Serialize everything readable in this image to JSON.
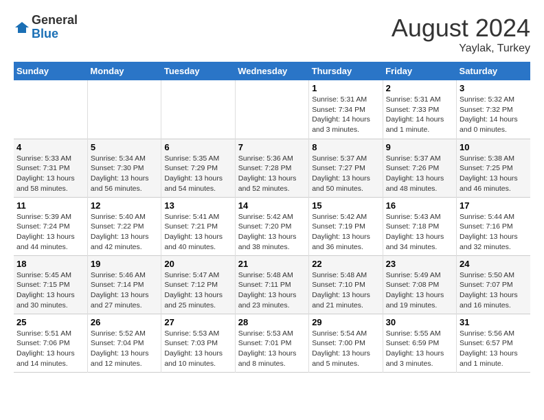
{
  "header": {
    "logo_general": "General",
    "logo_blue": "Blue",
    "month_year": "August 2024",
    "location": "Yaylak, Turkey"
  },
  "days_of_week": [
    "Sunday",
    "Monday",
    "Tuesday",
    "Wednesday",
    "Thursday",
    "Friday",
    "Saturday"
  ],
  "weeks": [
    [
      {
        "day": "",
        "info": ""
      },
      {
        "day": "",
        "info": ""
      },
      {
        "day": "",
        "info": ""
      },
      {
        "day": "",
        "info": ""
      },
      {
        "day": "1",
        "info": "Sunrise: 5:31 AM\nSunset: 7:34 PM\nDaylight: 14 hours\nand 3 minutes."
      },
      {
        "day": "2",
        "info": "Sunrise: 5:31 AM\nSunset: 7:33 PM\nDaylight: 14 hours\nand 1 minute."
      },
      {
        "day": "3",
        "info": "Sunrise: 5:32 AM\nSunset: 7:32 PM\nDaylight: 14 hours\nand 0 minutes."
      }
    ],
    [
      {
        "day": "4",
        "info": "Sunrise: 5:33 AM\nSunset: 7:31 PM\nDaylight: 13 hours\nand 58 minutes."
      },
      {
        "day": "5",
        "info": "Sunrise: 5:34 AM\nSunset: 7:30 PM\nDaylight: 13 hours\nand 56 minutes."
      },
      {
        "day": "6",
        "info": "Sunrise: 5:35 AM\nSunset: 7:29 PM\nDaylight: 13 hours\nand 54 minutes."
      },
      {
        "day": "7",
        "info": "Sunrise: 5:36 AM\nSunset: 7:28 PM\nDaylight: 13 hours\nand 52 minutes."
      },
      {
        "day": "8",
        "info": "Sunrise: 5:37 AM\nSunset: 7:27 PM\nDaylight: 13 hours\nand 50 minutes."
      },
      {
        "day": "9",
        "info": "Sunrise: 5:37 AM\nSunset: 7:26 PM\nDaylight: 13 hours\nand 48 minutes."
      },
      {
        "day": "10",
        "info": "Sunrise: 5:38 AM\nSunset: 7:25 PM\nDaylight: 13 hours\nand 46 minutes."
      }
    ],
    [
      {
        "day": "11",
        "info": "Sunrise: 5:39 AM\nSunset: 7:24 PM\nDaylight: 13 hours\nand 44 minutes."
      },
      {
        "day": "12",
        "info": "Sunrise: 5:40 AM\nSunset: 7:22 PM\nDaylight: 13 hours\nand 42 minutes."
      },
      {
        "day": "13",
        "info": "Sunrise: 5:41 AM\nSunset: 7:21 PM\nDaylight: 13 hours\nand 40 minutes."
      },
      {
        "day": "14",
        "info": "Sunrise: 5:42 AM\nSunset: 7:20 PM\nDaylight: 13 hours\nand 38 minutes."
      },
      {
        "day": "15",
        "info": "Sunrise: 5:42 AM\nSunset: 7:19 PM\nDaylight: 13 hours\nand 36 minutes."
      },
      {
        "day": "16",
        "info": "Sunrise: 5:43 AM\nSunset: 7:18 PM\nDaylight: 13 hours\nand 34 minutes."
      },
      {
        "day": "17",
        "info": "Sunrise: 5:44 AM\nSunset: 7:16 PM\nDaylight: 13 hours\nand 32 minutes."
      }
    ],
    [
      {
        "day": "18",
        "info": "Sunrise: 5:45 AM\nSunset: 7:15 PM\nDaylight: 13 hours\nand 30 minutes."
      },
      {
        "day": "19",
        "info": "Sunrise: 5:46 AM\nSunset: 7:14 PM\nDaylight: 13 hours\nand 27 minutes."
      },
      {
        "day": "20",
        "info": "Sunrise: 5:47 AM\nSunset: 7:12 PM\nDaylight: 13 hours\nand 25 minutes."
      },
      {
        "day": "21",
        "info": "Sunrise: 5:48 AM\nSunset: 7:11 PM\nDaylight: 13 hours\nand 23 minutes."
      },
      {
        "day": "22",
        "info": "Sunrise: 5:48 AM\nSunset: 7:10 PM\nDaylight: 13 hours\nand 21 minutes."
      },
      {
        "day": "23",
        "info": "Sunrise: 5:49 AM\nSunset: 7:08 PM\nDaylight: 13 hours\nand 19 minutes."
      },
      {
        "day": "24",
        "info": "Sunrise: 5:50 AM\nSunset: 7:07 PM\nDaylight: 13 hours\nand 16 minutes."
      }
    ],
    [
      {
        "day": "25",
        "info": "Sunrise: 5:51 AM\nSunset: 7:06 PM\nDaylight: 13 hours\nand 14 minutes."
      },
      {
        "day": "26",
        "info": "Sunrise: 5:52 AM\nSunset: 7:04 PM\nDaylight: 13 hours\nand 12 minutes."
      },
      {
        "day": "27",
        "info": "Sunrise: 5:53 AM\nSunset: 7:03 PM\nDaylight: 13 hours\nand 10 minutes."
      },
      {
        "day": "28",
        "info": "Sunrise: 5:53 AM\nSunset: 7:01 PM\nDaylight: 13 hours\nand 8 minutes."
      },
      {
        "day": "29",
        "info": "Sunrise: 5:54 AM\nSunset: 7:00 PM\nDaylight: 13 hours\nand 5 minutes."
      },
      {
        "day": "30",
        "info": "Sunrise: 5:55 AM\nSunset: 6:59 PM\nDaylight: 13 hours\nand 3 minutes."
      },
      {
        "day": "31",
        "info": "Sunrise: 5:56 AM\nSunset: 6:57 PM\nDaylight: 13 hours\nand 1 minute."
      }
    ]
  ]
}
